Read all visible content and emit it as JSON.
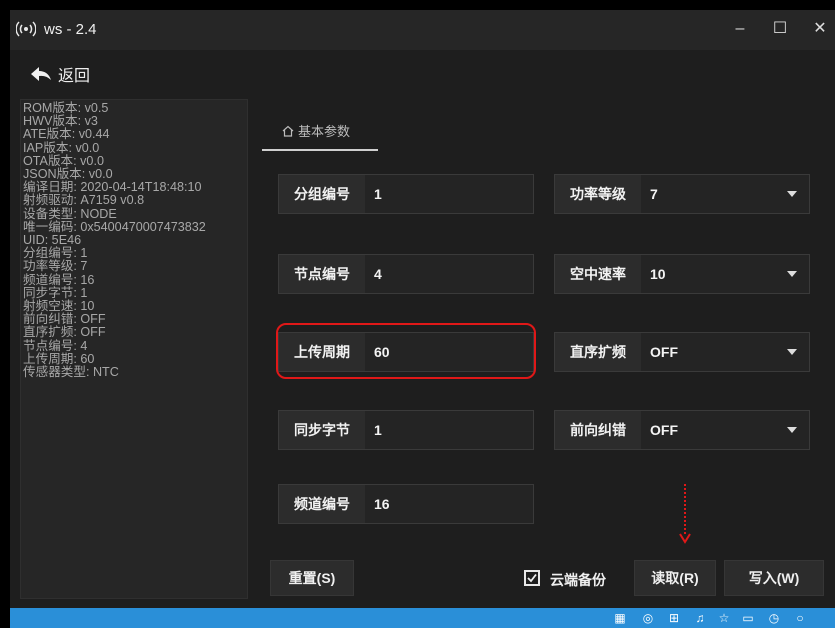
{
  "window": {
    "title": "ws - 2.4"
  },
  "nav": {
    "back_label": "返回"
  },
  "info": {
    "lines": [
      "ROM版本: v0.5",
      "HWV版本: v3",
      "ATE版本: v0.44",
      "IAP版本: v0.0",
      "OTA版本: v0.0",
      "JSON版本: v0.0",
      "编译日期: 2020-04-14T18:48:10",
      "射频驱动: A7159 v0.8",
      "设备类型: NODE",
      "唯一编码: 0x5400470007473832",
      "UID: 5E46",
      "分组编号: 1",
      "功率等级: 7",
      "频道编号: 16",
      "同步字节: 1",
      "射频空速: 10",
      "前向纠错: OFF",
      "直序扩频: OFF",
      "节点编号: 4",
      "上传周期: 60",
      "传感器类型: NTC"
    ]
  },
  "tab": {
    "label": "基本参数"
  },
  "fields": {
    "group_id": {
      "label": "分组编号",
      "value": "1"
    },
    "node_id": {
      "label": "节点编号",
      "value": "4"
    },
    "upload_period": {
      "label": "上传周期",
      "value": "60"
    },
    "sync_byte": {
      "label": "同步字节",
      "value": "1"
    },
    "channel": {
      "label": "频道编号",
      "value": "16"
    },
    "power_level": {
      "label": "功率等级",
      "value": "7"
    },
    "air_rate": {
      "label": "空中速率",
      "value": "10"
    },
    "dsss": {
      "label": "直序扩频",
      "value": "OFF"
    },
    "fec": {
      "label": "前向纠错",
      "value": "OFF"
    }
  },
  "actions": {
    "reset": "重置(S)",
    "cloud_backup": "云端备份",
    "cloud_backup_checked": true,
    "read": "读取(R)",
    "write": "写入(W)"
  },
  "colors": {
    "highlight": "#e01818",
    "taskbar": "#2a8fd8"
  }
}
